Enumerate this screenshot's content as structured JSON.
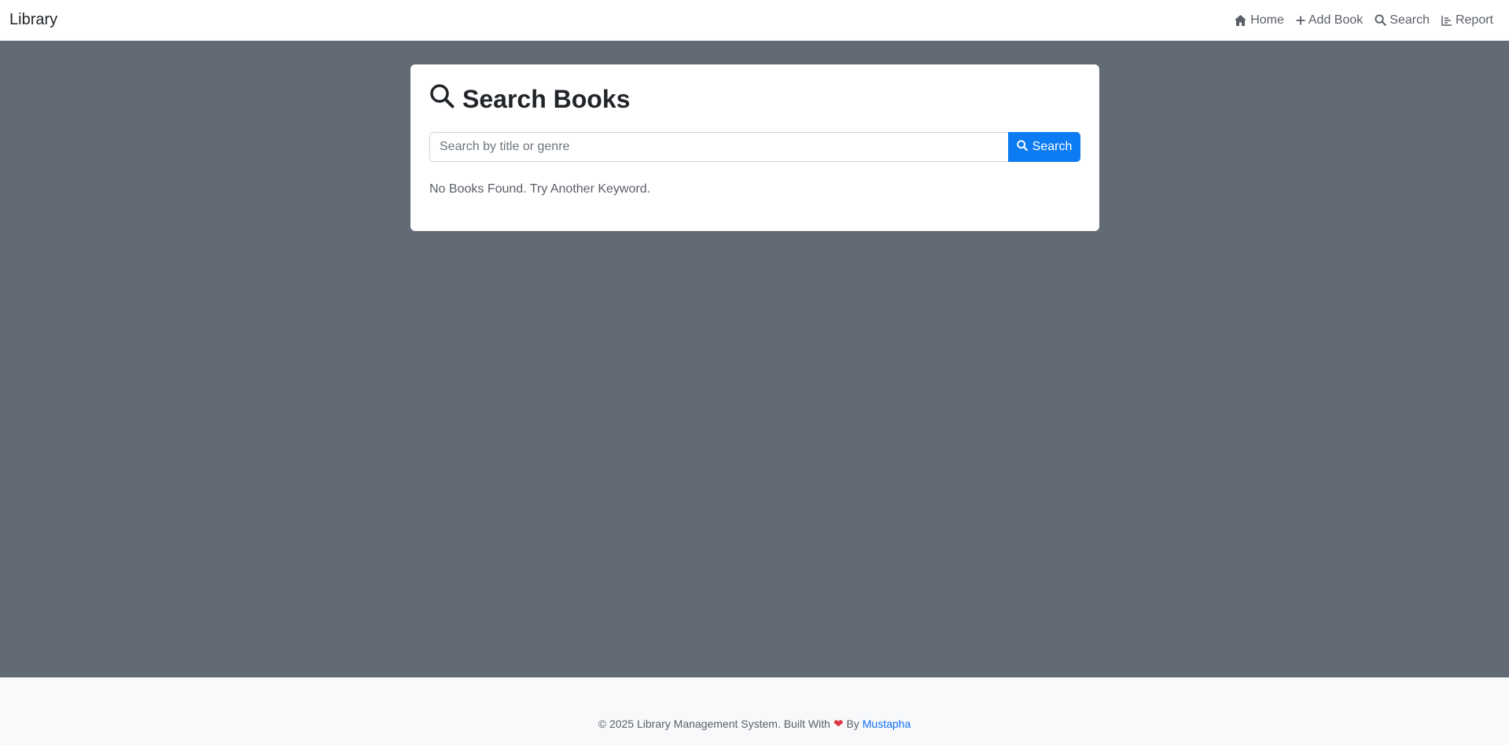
{
  "navbar": {
    "brand": "Library",
    "links": [
      {
        "label": "Home",
        "icon": "home-icon"
      },
      {
        "label": "Add Book",
        "icon": "plus-icon"
      },
      {
        "label": "Search",
        "icon": "search-icon"
      },
      {
        "label": "Report",
        "icon": "report-icon"
      }
    ]
  },
  "search_card": {
    "title": "Search Books",
    "placeholder": "Search by title or genre",
    "value": "",
    "button_label": "Search",
    "empty_message": "No Books Found. Try Another Keyword."
  },
  "footer": {
    "text_before": "© 2025 Library Management System. Built With",
    "heart": "❤",
    "text_by": "By",
    "author": "Mustapha"
  },
  "colors": {
    "background": "#616a75",
    "accent": "#0d7cf2",
    "heart": "#dc3545",
    "link": "#0d6efd"
  }
}
